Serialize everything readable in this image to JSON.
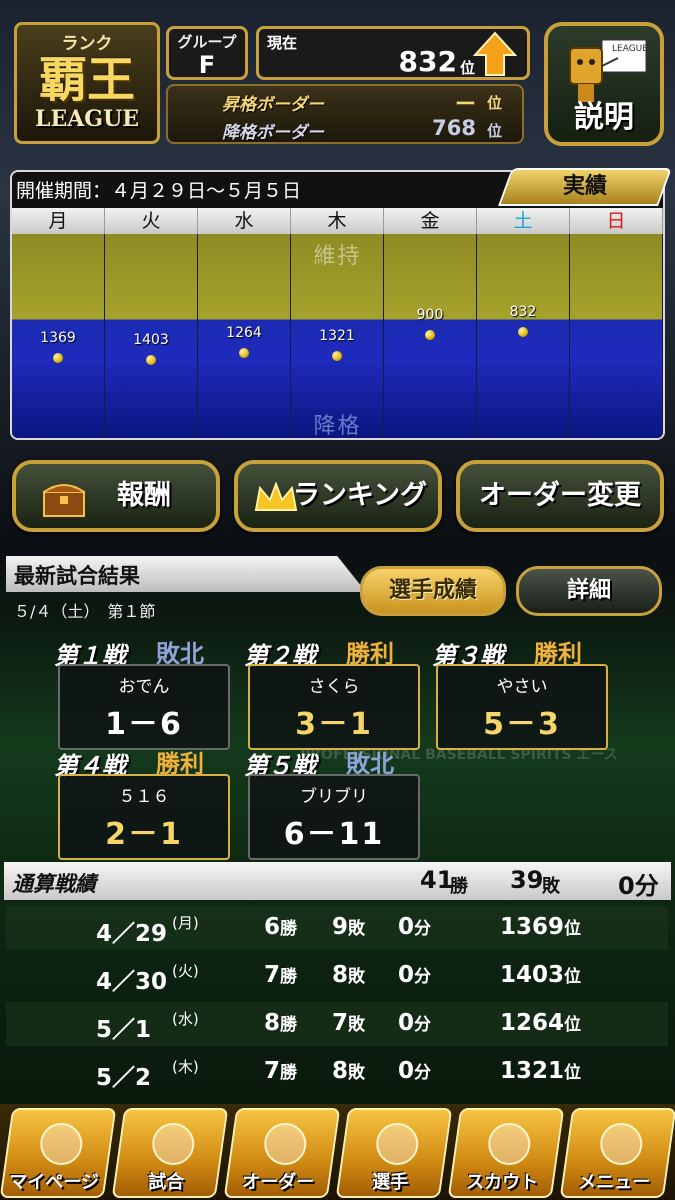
{
  "header": {
    "rank_label": "ランク",
    "rank_main": "覇王",
    "rank_sub": "LEAGUE",
    "group_label": "グループ",
    "group_value": "F",
    "current_label": "現在",
    "current_value": "832",
    "current_unit": "位",
    "promote_label": "昇格ボーダー",
    "promote_value": "ー",
    "promote_unit": "位",
    "demote_label": "降格ボーダー",
    "demote_value": "768",
    "demote_unit": "位",
    "help_label": "説明",
    "help_sign": "LEAGUE"
  },
  "schedule": {
    "period": "開催期間：４月２９日～５月５日",
    "record_tab": "実績",
    "days": [
      "月",
      "火",
      "水",
      "木",
      "金",
      "土",
      "日"
    ],
    "day_colors": [
      "#111111",
      "#111111",
      "#111111",
      "#111111",
      "#111111",
      "#1aa6d8",
      "#d81a1a"
    ],
    "stay_label": "維持",
    "demote_label": "降格"
  },
  "chart_data": {
    "type": "scatter",
    "categories": [
      "月",
      "火",
      "水",
      "木",
      "金",
      "土",
      "日"
    ],
    "values": [
      1369,
      1403,
      1264,
      1321,
      900,
      832,
      null
    ]
  },
  "buttons": {
    "reward": "報酬",
    "ranking": "ランキング",
    "order": "オーダー変更"
  },
  "results": {
    "title": "最新試合結果",
    "subtitle": "５/４（土）　第１節",
    "player_btn": "選手成績",
    "detail_btn": "詳細",
    "games": [
      {
        "title": "第１戦",
        "result": "敗北",
        "opponent": "おでん",
        "score": "1－6"
      },
      {
        "title": "第２戦",
        "result": "勝利",
        "opponent": "さくら",
        "score": "3－1"
      },
      {
        "title": "第３戦",
        "result": "勝利",
        "opponent": "やさい",
        "score": "5－3"
      },
      {
        "title": "第４戦",
        "result": "勝利",
        "opponent": "５１６",
        "score": "2－1"
      },
      {
        "title": "第５戦",
        "result": "敗北",
        "opponent": "ブリブリ",
        "score": "6－11"
      }
    ]
  },
  "totals": {
    "title": "通算戦績",
    "wins": "41",
    "win_unit": "勝",
    "losses": "39",
    "loss_unit": "敗",
    "draw_unit": "0分",
    "rows": [
      {
        "date": "4／29",
        "dow": "(月)",
        "w": "6",
        "l": "9",
        "d": "0",
        "rank": "1369"
      },
      {
        "date": "4／30",
        "dow": "(火)",
        "w": "7",
        "l": "8",
        "d": "0",
        "rank": "1403"
      },
      {
        "date": "5／1",
        "dow": "(水)",
        "w": "8",
        "l": "7",
        "d": "0",
        "rank": "1264"
      },
      {
        "date": "5／2",
        "dow": "(木)",
        "w": "7",
        "l": "8",
        "d": "0",
        "rank": "1321"
      }
    ],
    "units": {
      "win": "勝",
      "loss": "敗",
      "draw": "分",
      "rank": "位"
    }
  },
  "nav": [
    "マイページ",
    "試合",
    "オーダー",
    "選手",
    "スカウト",
    "メニュー"
  ],
  "bg_watermark": "PROFESSIONAL BASEBALL SPIRITS エース"
}
